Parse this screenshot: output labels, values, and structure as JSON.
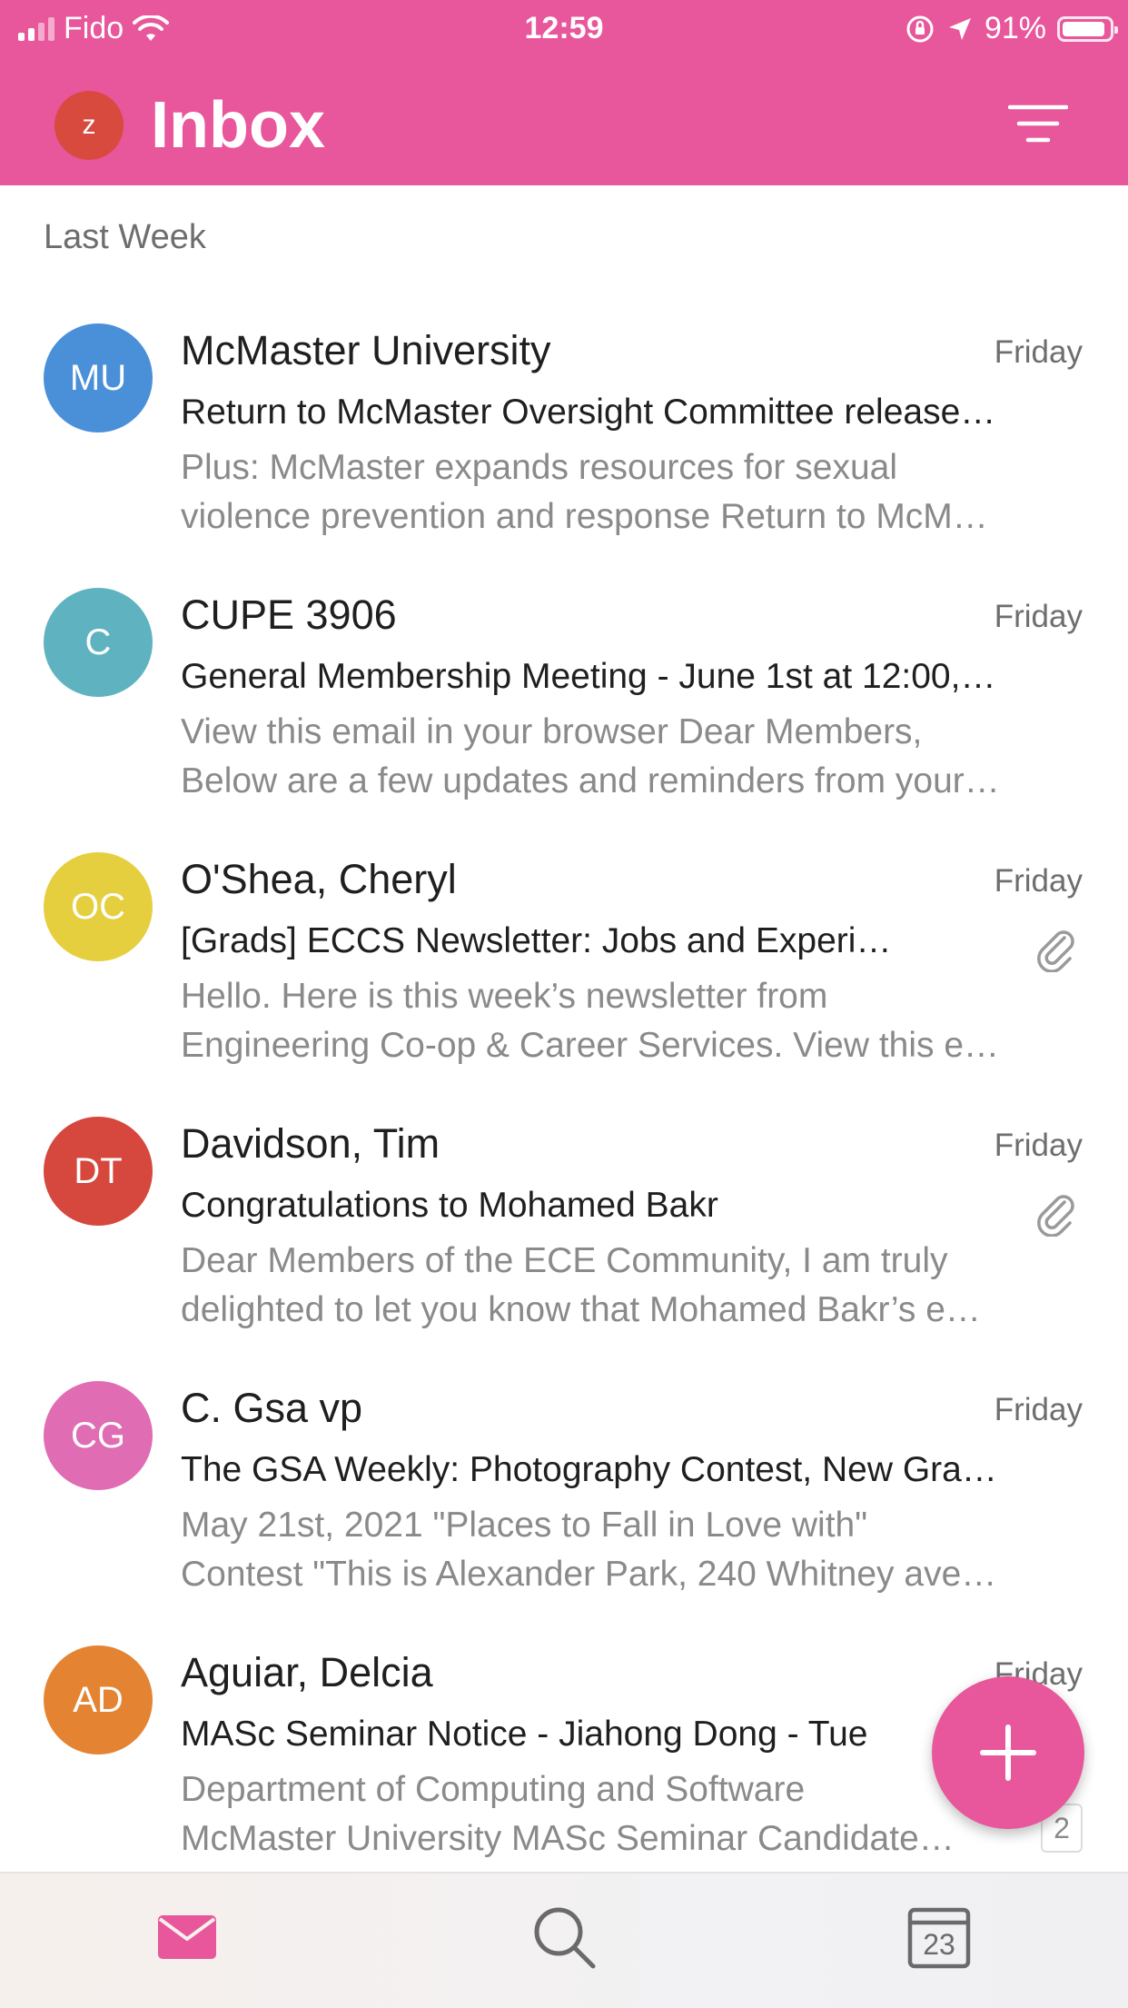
{
  "status_bar": {
    "carrier": "Fido",
    "time": "12:59",
    "battery_percent": "91%"
  },
  "header": {
    "avatar_initial": "z",
    "title": "Inbox"
  },
  "section_label": "Last Week",
  "colors": {
    "accent": "#e8569b",
    "avatar_mu": "#4a90d9",
    "avatar_c": "#5fb3c0",
    "avatar_oc": "#e5cf3f",
    "avatar_dt": "#d6473d",
    "avatar_cg": "#e06cb3",
    "avatar_ad": "#e48433"
  },
  "emails": [
    {
      "initials": "MU",
      "sender": "McMaster University",
      "date": "Friday",
      "subject": "Return to McMaster Oversight Committee release…",
      "preview_line1": "Plus: McMaster expands resources for sexual",
      "preview_line2": "violence prevention and response Return to McM…",
      "has_attachment": false
    },
    {
      "initials": "C",
      "sender": "CUPE 3906",
      "date": "Friday",
      "subject": "General Membership Meeting - June 1st at 12:00,…",
      "preview_line1": "View this email in your browser Dear Members,",
      "preview_line2": "Below are a few updates and reminders from your…",
      "has_attachment": false
    },
    {
      "initials": "OC",
      "sender": "O'Shea, Cheryl",
      "date": "Friday",
      "subject": "[Grads] ECCS Newsletter: Jobs and Experi…",
      "preview_line1": "Hello. Here is this week’s newsletter from",
      "preview_line2": "Engineering Co-op & Career Services. View this e…",
      "has_attachment": true
    },
    {
      "initials": "DT",
      "sender": "Davidson, Tim",
      "date": "Friday",
      "subject": "Congratulations to Mohamed Bakr",
      "preview_line1": "Dear Members of the ECE Community, I am truly",
      "preview_line2": "delighted to let you know that Mohamed Bakr’s e…",
      "has_attachment": true
    },
    {
      "initials": "CG",
      "sender": "C. Gsa vp",
      "date": "Friday",
      "subject": "The GSA Weekly: Photography Contest, New Gra…",
      "preview_line1": "May 21st, 2021 \"Places to Fall in Love with\"",
      "preview_line2": "Contest \"This is Alexander Park, 240 Whitney ave…",
      "has_attachment": false
    },
    {
      "initials": "AD",
      "sender": "Aguiar, Delcia",
      "date": "Friday",
      "subject": "MASc Seminar Notice - Jiahong Dong - Tue",
      "preview_line1": "Department of Computing and Software",
      "preview_line2": "McMaster University MASc Seminar Candidate…",
      "thread_count": "2"
    }
  ],
  "tabbar": {
    "mail_icon": "mail-icon",
    "search_icon": "search-icon",
    "calendar_day": "23"
  }
}
